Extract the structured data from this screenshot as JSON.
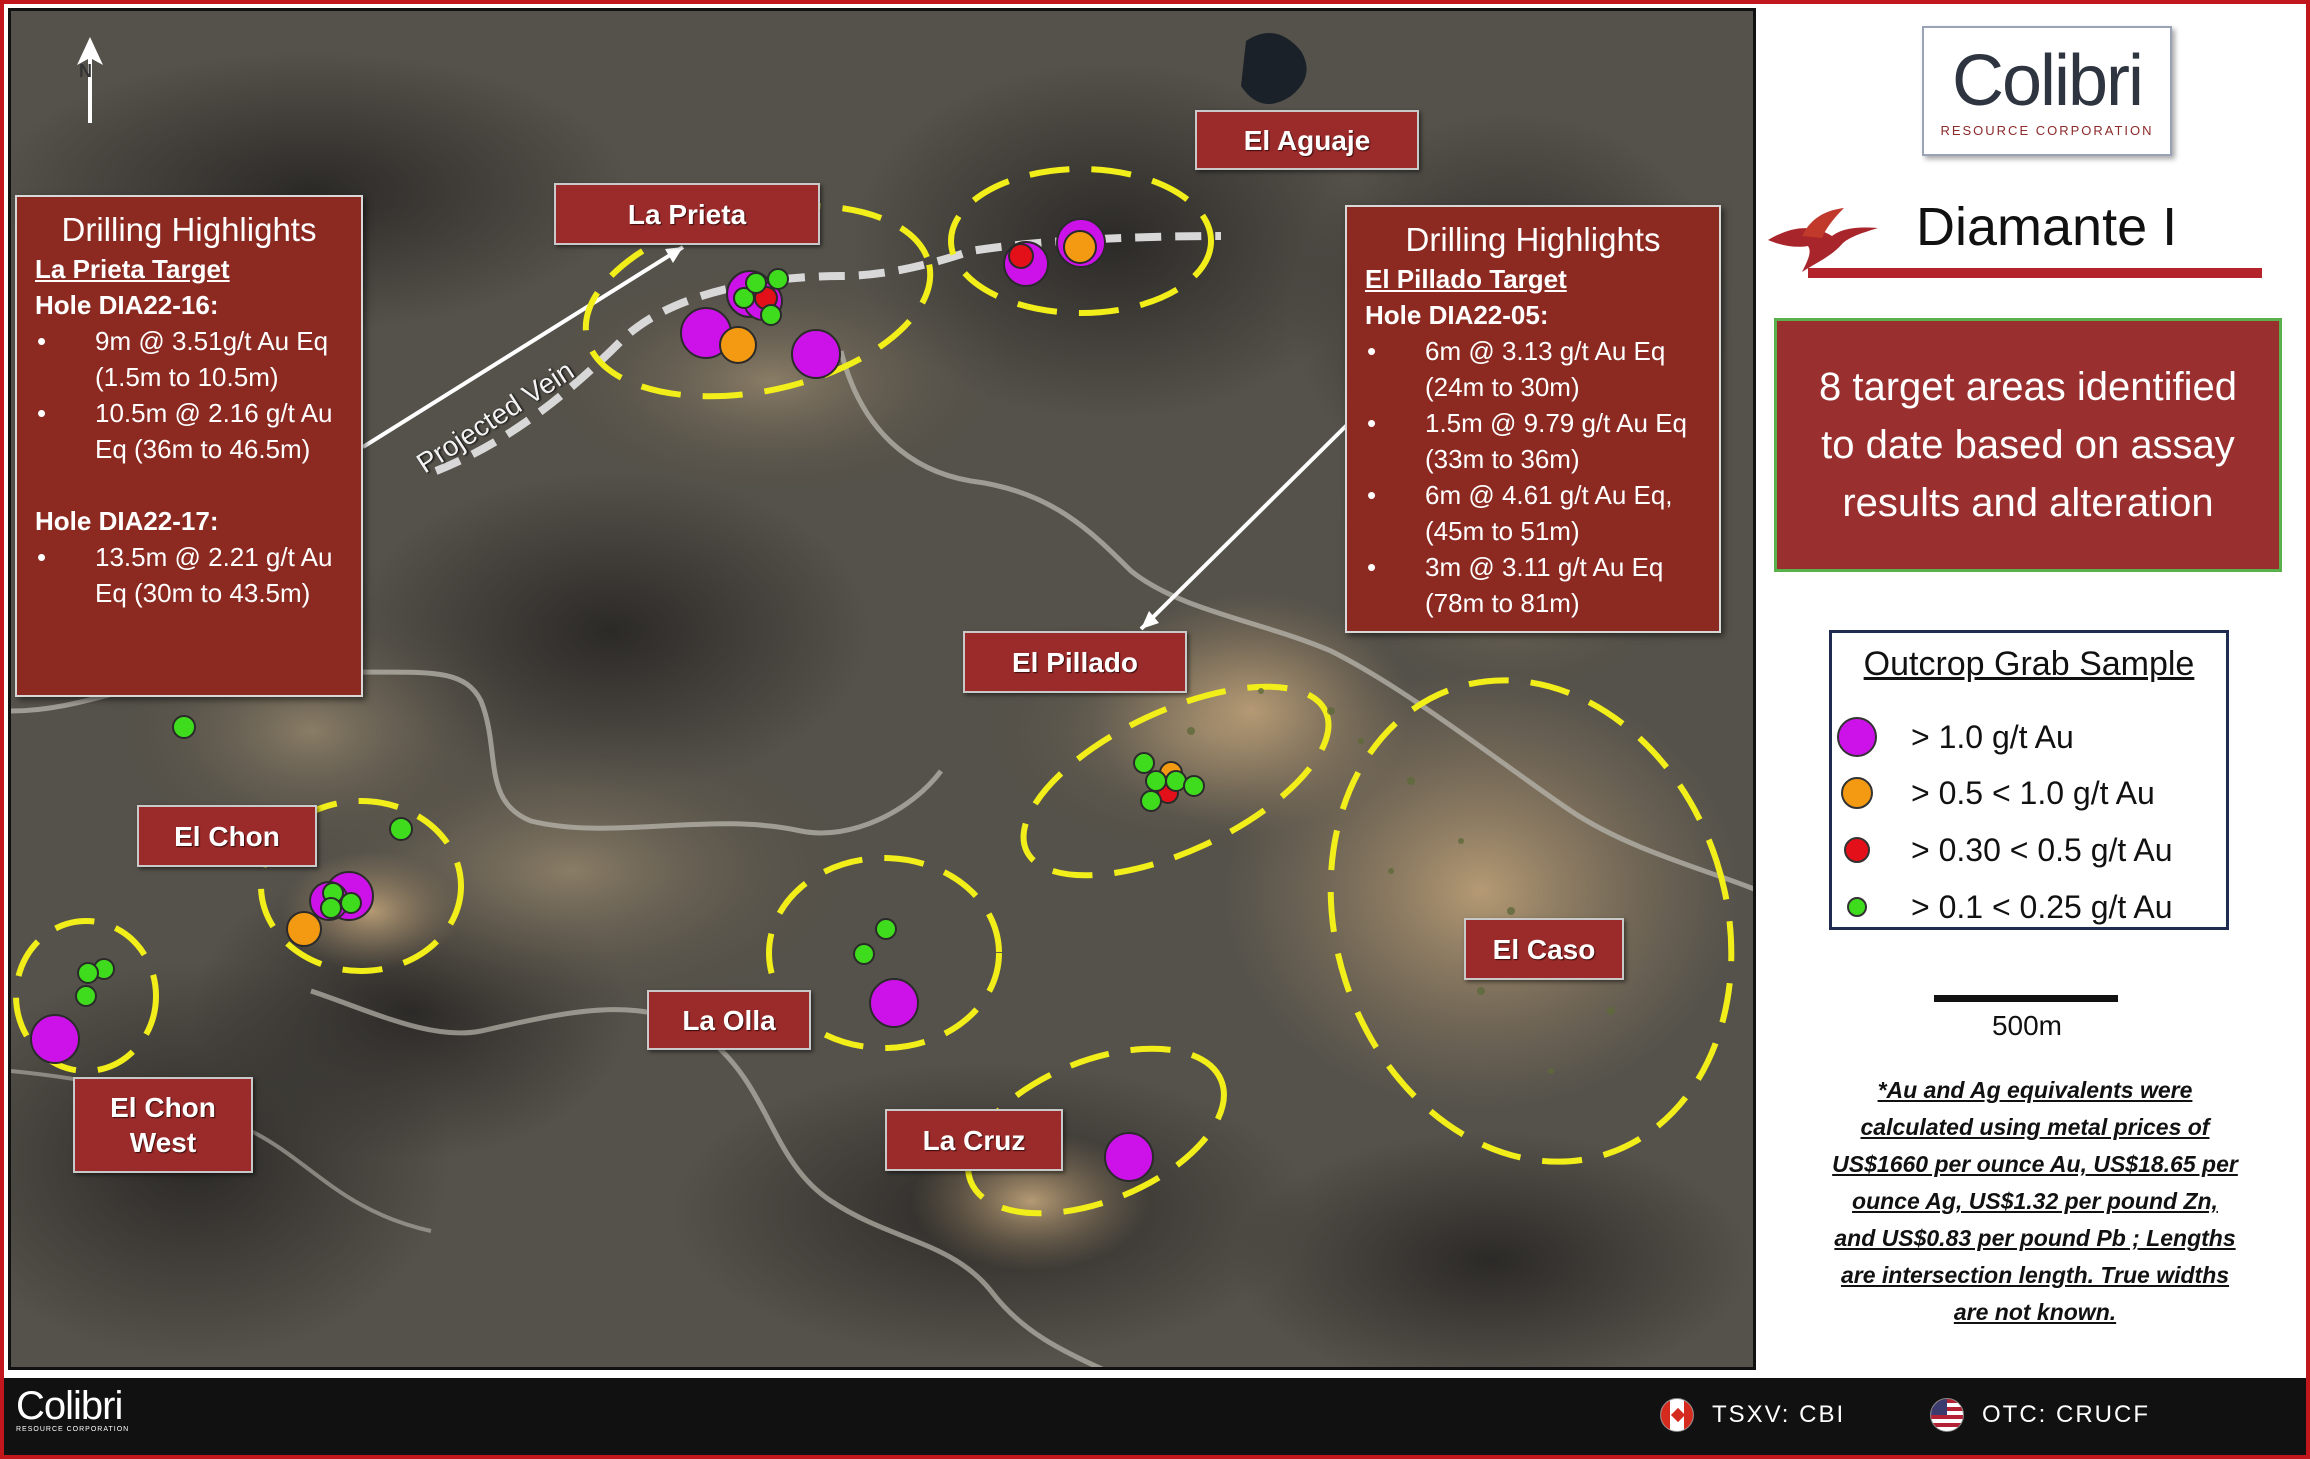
{
  "colors": {
    "brand_red": "#9a2f2f",
    "frame_red": "#c0161c",
    "highlight_yellow": "#f2ee1a",
    "dot_purple": "#cc12e8",
    "dot_orange": "#f39a12",
    "dot_red": "#e3101a",
    "dot_green": "#3fdc1e",
    "target_box_border": "#5ab04a"
  },
  "map": {
    "north_label": "N",
    "projected_vein_label": "Projected Vein",
    "target_labels": {
      "la_prieta": "La Prieta",
      "el_aguaje": "El Aguaje",
      "el_pillado": "El Pillado",
      "el_chon": "El Chon",
      "el_chon_west_line1": "El Chon",
      "el_chon_west_line2": "West",
      "la_olla": "La Olla",
      "la_cruz": "La Cruz",
      "el_caso": "El Caso"
    },
    "drilling_left": {
      "title": "Drilling Highlights",
      "target": "La Prieta Target",
      "hole1": "Hole DIA22-16",
      "hole1_items": [
        "9m @ 3.51g/t Au Eq (1.5m to 10.5m)",
        "10.5m @ 2.16 g/t Au Eq (36m to 46.5m)"
      ],
      "hole2": "Hole DIA22-17:",
      "hole2_items": [
        "13.5m @ 2.21 g/t Au Eq (30m to 43.5m)"
      ]
    },
    "drilling_right": {
      "title": "Drilling Highlights",
      "target": "El Pillado Target",
      "hole1": "Hole DIA22-05",
      "hole1_items": [
        "6m @ 3.13 g/t Au Eq (24m to 30m)",
        "1.5m @ 9.79 g/t Au Eq (33m to 36m)",
        "6m @ 4.61 g/t Au Eq, (45m to 51m)",
        "3m @ 3.11 g/t Au Eq (78m to 81m)"
      ]
    },
    "samples": [
      {
        "grade": "purple"
      },
      {
        "grade": "orange"
      },
      {
        "grade": "red"
      },
      {
        "grade": "green"
      }
    ]
  },
  "panel": {
    "logo_name": "Colibri",
    "logo_sub": "RESOURCE CORPORATION",
    "title": "Diamante I",
    "target_box": "8 target areas identified to date based on assay results and alteration",
    "legend": {
      "title": "Outcrop Grab Sample",
      "items": [
        {
          "label": "> 1.0 g/t Au",
          "color": "#cc12e8"
        },
        {
          "label": "> 0.5 < 1.0 g/t Au",
          "color": "#f39a12"
        },
        {
          "label": "> 0.30 < 0.5 g/t Au",
          "color": "#e3101a"
        },
        {
          "label": "> 0.1 < 0.25 g/t Au",
          "color": "#3fdc1e"
        }
      ]
    },
    "scale_label": "500m",
    "note": "*Au and Ag equivalents were calculated using metal prices of US$1660 per ounce Au, US$18.65 per ounce Ag, US$1.32 per pound Zn, and US$0.83 per pound Pb ; Lengths are intersection length. True widths are not known."
  },
  "footer": {
    "logo_name": "Colibri",
    "logo_sub": "RESOURCE CORPORATION",
    "tsxv": "TSXV: CBI",
    "otc": "OTC: CRUCF"
  }
}
